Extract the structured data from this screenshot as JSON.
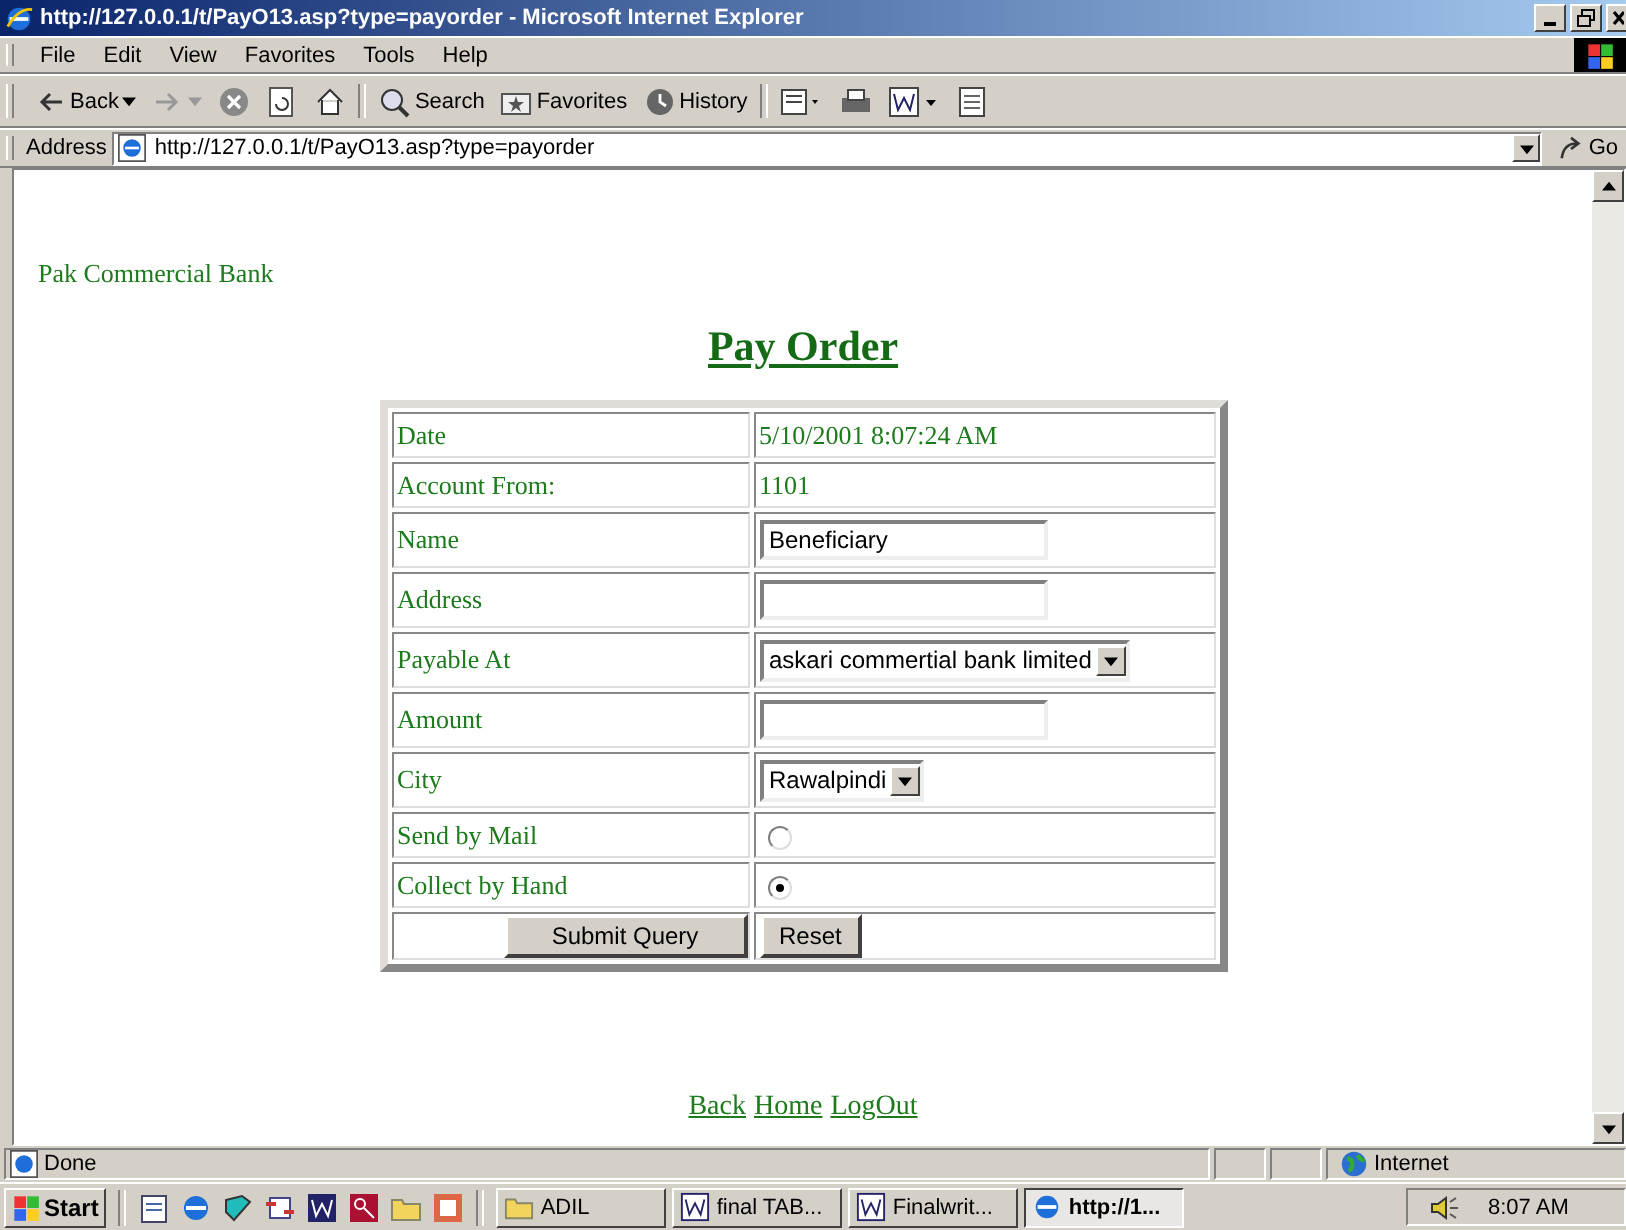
{
  "window": {
    "title": "http://127.0.0.1/t/PayO13.asp?type=payorder - Microsoft Internet Explorer"
  },
  "menu": [
    "File",
    "Edit",
    "View",
    "Favorites",
    "Tools",
    "Help"
  ],
  "toolbar": [
    {
      "kind": "back",
      "label": "Back"
    },
    {
      "kind": "forward"
    },
    {
      "kind": "stop"
    },
    {
      "kind": "refresh"
    },
    {
      "kind": "home"
    },
    {
      "kind": "search",
      "label": "Search"
    },
    {
      "kind": "favorites",
      "label": "Favorites"
    },
    {
      "kind": "history",
      "label": "History"
    },
    {
      "kind": "mail"
    },
    {
      "kind": "print"
    },
    {
      "kind": "edit"
    },
    {
      "kind": "discuss"
    }
  ],
  "address": {
    "label": "Address",
    "url": "http://127.0.0.1/t/PayO13.asp?type=payorder",
    "go": "Go"
  },
  "page": {
    "bank": "Pak Commercial Bank",
    "heading": "Pay Order",
    "rows": [
      {
        "label": "Date",
        "kind": "text",
        "value": "5/10/2001 8:07:24 AM"
      },
      {
        "label": "Account From:",
        "kind": "text",
        "value": "1101"
      },
      {
        "label": "Name",
        "kind": "input",
        "value": "Beneficiary"
      },
      {
        "label": "Address",
        "kind": "input"
      },
      {
        "label": "Payable At",
        "kind": "select",
        "value": "askari commertial bank limited"
      },
      {
        "label": "Amount",
        "kind": "input"
      },
      {
        "label": "City",
        "kind": "select",
        "value": "Rawalpindi"
      },
      {
        "label": "Send by Mail",
        "kind": "radio",
        "checked": false
      },
      {
        "label": "Collect by Hand",
        "kind": "radio",
        "checked": true
      }
    ],
    "submit": "Submit Query",
    "reset": "Reset",
    "links": [
      "Back",
      "Home",
      "LogOut"
    ]
  },
  "status": {
    "text": "Done",
    "zone": "Internet"
  },
  "taskbar": {
    "start": "Start",
    "tasks": [
      {
        "label": "ADIL",
        "kind": "folder",
        "selected": false
      },
      {
        "label": "final TAB...",
        "kind": "word",
        "selected": false
      },
      {
        "label": "Finalwrit...",
        "kind": "word",
        "selected": false
      },
      {
        "label": "http://1...",
        "kind": "ie",
        "selected": true
      }
    ],
    "clock": "8:07 AM"
  }
}
